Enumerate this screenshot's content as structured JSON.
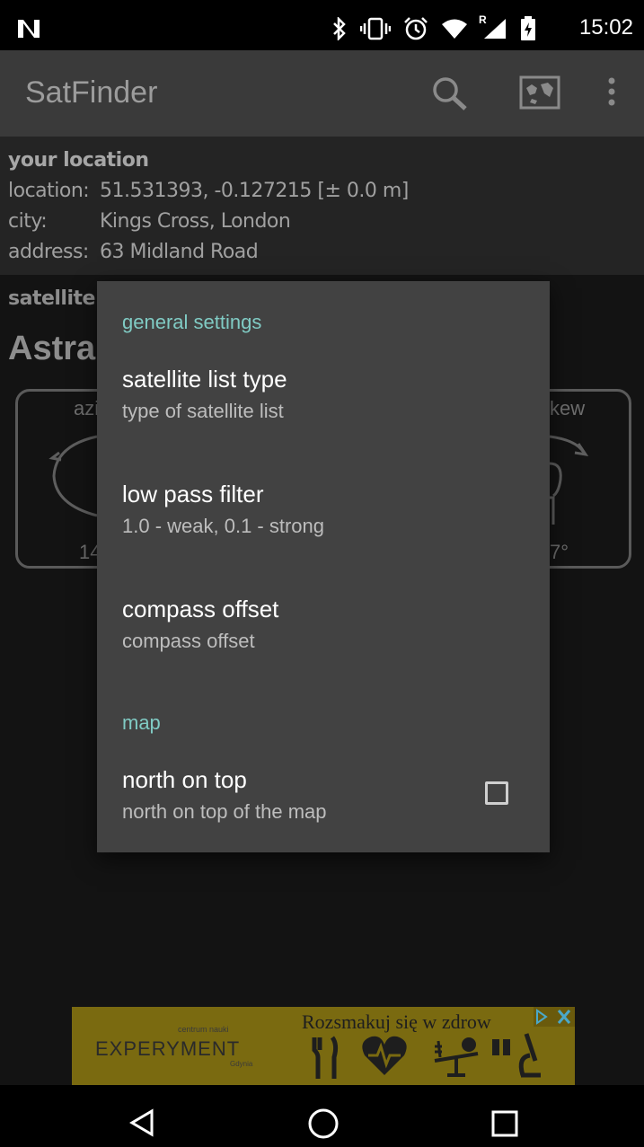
{
  "status_bar": {
    "time": "15:02",
    "roaming_mark": "R",
    "icons": [
      "notification-n-icon",
      "bluetooth-icon",
      "vibrate-icon",
      "alarm-icon",
      "wifi-icon",
      "signal-icon",
      "battery-icon"
    ]
  },
  "app_bar": {
    "title": "SatFinder",
    "actions": [
      "search-icon",
      "map-icon",
      "overflow-menu-icon"
    ]
  },
  "location": {
    "header": "your location",
    "rows": [
      {
        "label": "location:",
        "value": "51.531393, -0.127215 [± 0.0 m]"
      },
      {
        "label": "city:",
        "value": "Kings Cross, London"
      },
      {
        "label": "address:",
        "value": "63 Midland Road"
      }
    ]
  },
  "satellite": {
    "label": "satellite",
    "name": "Astra",
    "left_gauge": {
      "label_fragment": "azi",
      "value_fragment": "14"
    },
    "right_gauge": {
      "label_fragment": "kew",
      "value_fragment": "7°"
    }
  },
  "dialog": {
    "general_header": "general settings",
    "map_header": "map",
    "prefs": [
      {
        "title": "satellite list type",
        "summary": "type of satellite list"
      },
      {
        "title": "low pass filter",
        "summary": "1.0 - weak, 0.1 - strong"
      },
      {
        "title": "compass offset",
        "summary": "compass offset"
      },
      {
        "title": "north on top",
        "summary": "north on top of the map",
        "checked": false
      }
    ]
  },
  "ad": {
    "brand_small": "centrum nauki",
    "brand": "EXPERYMENT",
    "brand_city": "Gdynia",
    "slogan": "Rozsmakuj się w zdrow"
  },
  "nav_bar": {
    "buttons": [
      "back-icon",
      "home-icon",
      "recents-icon"
    ]
  },
  "colors": {
    "accent": "#80cbc4",
    "dialog_bg": "#424242",
    "app_bar_bg": "#3a3a3a"
  }
}
